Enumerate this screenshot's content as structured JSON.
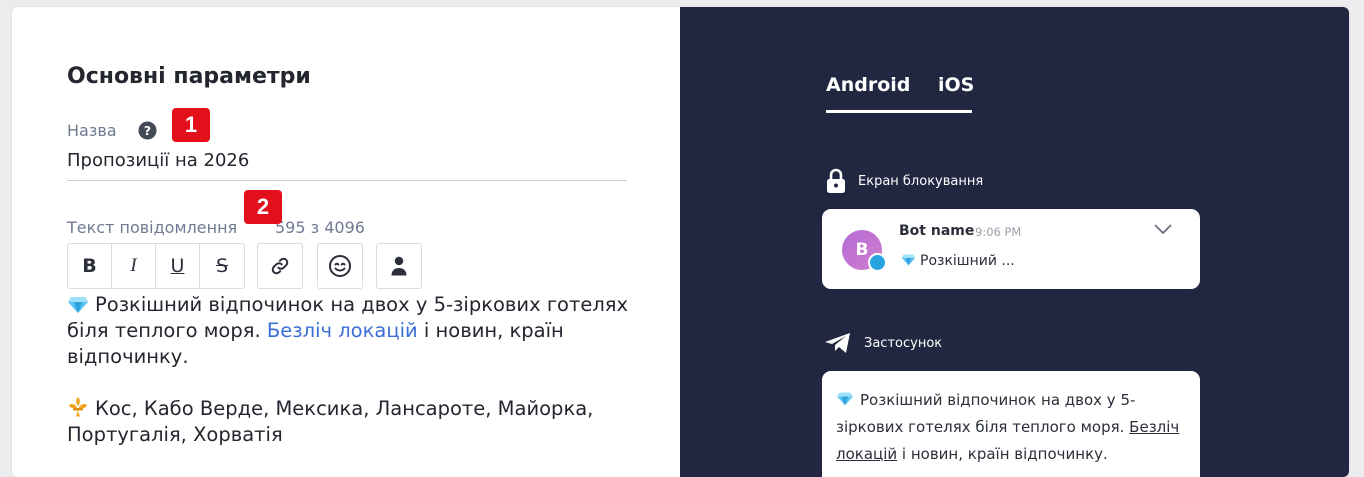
{
  "form": {
    "section_title": "Основні параметри",
    "name_label": "Назва",
    "name_help_icon": "question-circle-icon",
    "name_value": "Пропозиції на 2026",
    "message_label": "Текст повідомлення",
    "message_counter": "595 з 4096"
  },
  "badges": [
    "1",
    "2"
  ],
  "toolbar": {
    "bold": "B",
    "italic": "I",
    "underline": "U",
    "strike": "S",
    "icons": [
      "link-icon",
      "emoji-icon",
      "user-icon"
    ]
  },
  "editor": {
    "p1_text": "Розкішний відпочинок на двох у 5-зіркових готелях біля теплого моря. ",
    "p1_link": "Безліч локацій",
    "p1_tail": " і новин, країн відпочинку.",
    "p2_text": "Кос, Кабо Верде, Мексика, Лансароте, Майорка, Португалія, Хорватія",
    "icons": [
      "diamond-icon",
      "fleur-de-lis-icon"
    ]
  },
  "preview": {
    "tabs": [
      "Android",
      "iOS"
    ],
    "active_tab": "Android",
    "lock_screen_label": "Екран блокування",
    "notification": {
      "avatar_letter": "B",
      "title": "Bot name",
      "time": "9:06 PM",
      "text": "Розкішний ..."
    },
    "app_label": "Застосунок",
    "app_message": {
      "text": "Розкішний відпочинок на двох у 5-зіркових готелях біля теплого моря.",
      "link": "Безліч локацій",
      "tail": " і новин, країн відпочинку."
    }
  },
  "colors": {
    "preview_bg": "#212740",
    "link": "#3b6fd6",
    "badge": "#e3101c",
    "muted_label": "#6f7a92"
  }
}
